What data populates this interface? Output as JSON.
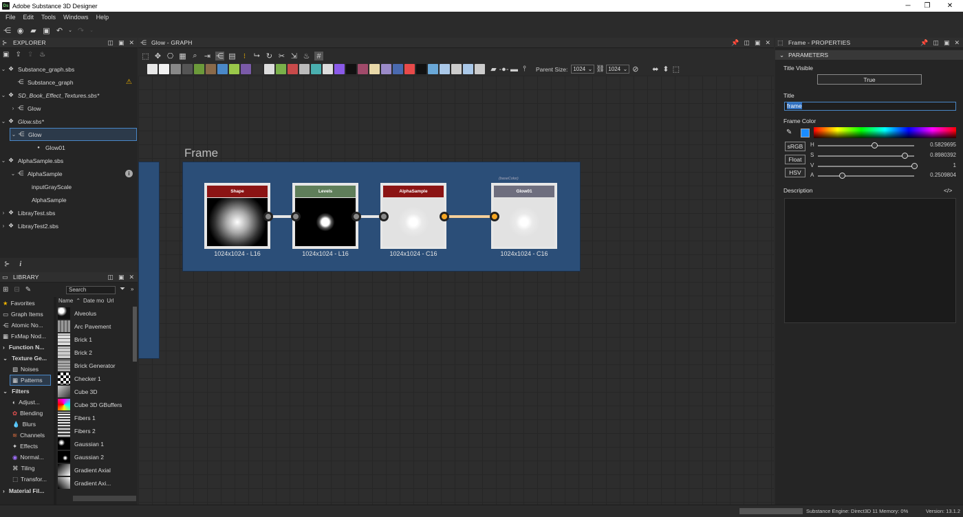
{
  "window": {
    "title": "Adobe Substance 3D Designer",
    "app_icon": "Ds"
  },
  "menu": [
    "File",
    "Edit",
    "Tools",
    "Windows",
    "Help"
  ],
  "explorer": {
    "title": "EXPLORER",
    "items": [
      {
        "label": "Substance_graph.sbs",
        "italic": false
      },
      {
        "label": "Substance_graph",
        "italic": false
      },
      {
        "label": "SD_Book_Effect_Textures.sbs*",
        "italic": true
      },
      {
        "label": "Glow",
        "italic": false
      },
      {
        "label": "Glow.sbs*",
        "italic": true
      },
      {
        "label": "Glow",
        "italic": false
      },
      {
        "label": "Glow01",
        "italic": false
      },
      {
        "label": "AlphaSample.sbs",
        "italic": false
      },
      {
        "label": "AlphaSample",
        "italic": false
      },
      {
        "label": "inputGrayScale",
        "italic": false
      },
      {
        "label": "AlphaSample",
        "italic": false
      },
      {
        "label": "LibrayTest.sbs",
        "italic": false
      },
      {
        "label": "LibrayTest2.sbs",
        "italic": false
      }
    ]
  },
  "library": {
    "title": "LIBRARY",
    "search_placeholder": "Search",
    "columns": [
      "Name",
      "Date mo",
      "Url"
    ],
    "categories": [
      "Favorites",
      "Graph Items",
      "Atomic No...",
      "FxMap Nod...",
      "Function N...",
      "Texture Ge...",
      "Noises",
      "Patterns",
      "Filters",
      "Adjust...",
      "Blending",
      "Blurs",
      "Channels",
      "Effects",
      "Normal...",
      "Tiling",
      "Transfor...",
      "Material Fil..."
    ],
    "items": [
      "Alveolus",
      "Arc Pavement",
      "Brick 1",
      "Brick 2",
      "Brick Generator",
      "Checker 1",
      "Cube 3D",
      "Cube 3D GBuffers",
      "Fibers 1",
      "Fibers 2",
      "Gaussian 1",
      "Gaussian 2",
      "Gradient Axial",
      "Gradient Axi..."
    ]
  },
  "graph": {
    "title": "Glow - GRAPH",
    "parent_size_label": "Parent Size:",
    "parent_size_w": "1024",
    "parent_size_h": "1024",
    "frame_title": "Frame",
    "frame_color": "#2b4e78",
    "nodes": [
      {
        "name": "Shape",
        "label": "1024x1024 - L16",
        "header_color": "#8b1414"
      },
      {
        "name": "Levels",
        "label": "1024x1024 - L16",
        "header_color": "#5f7e5a"
      },
      {
        "name": "AlphaSample",
        "label": "1024x1024 - C16",
        "header_color": "#8b1414"
      },
      {
        "name": "Glow01",
        "label": "1024x1024 - C16",
        "header_color": "#6e6e7e",
        "tag": "(baseColor)"
      }
    ]
  },
  "properties": {
    "title": "Frame - PROPERTIES",
    "section": "PARAMETERS",
    "title_visible_label": "Title Visible",
    "title_visible_value": "True",
    "title_label": "Title",
    "title_value": "frame",
    "frame_color_label": "Frame Color",
    "color_modes": [
      "sRGB",
      "Float",
      "HSV"
    ],
    "hsv": [
      {
        "label": "H",
        "value": "0.5829695",
        "fraction": 0.5829695
      },
      {
        "label": "S",
        "value": "0.8980392",
        "fraction": 0.8980392
      },
      {
        "label": "V",
        "value": "1",
        "fraction": 1
      },
      {
        "label": "A",
        "value": "0.2509804",
        "fraction": 0.2509804
      }
    ],
    "swatch_color": "#1a8cff",
    "description_label": "Description",
    "description_code": "</>"
  },
  "status": {
    "engine": "Substance Engine: Direct3D 11  Memory: 0%",
    "version": "Version: 13.1.2"
  }
}
